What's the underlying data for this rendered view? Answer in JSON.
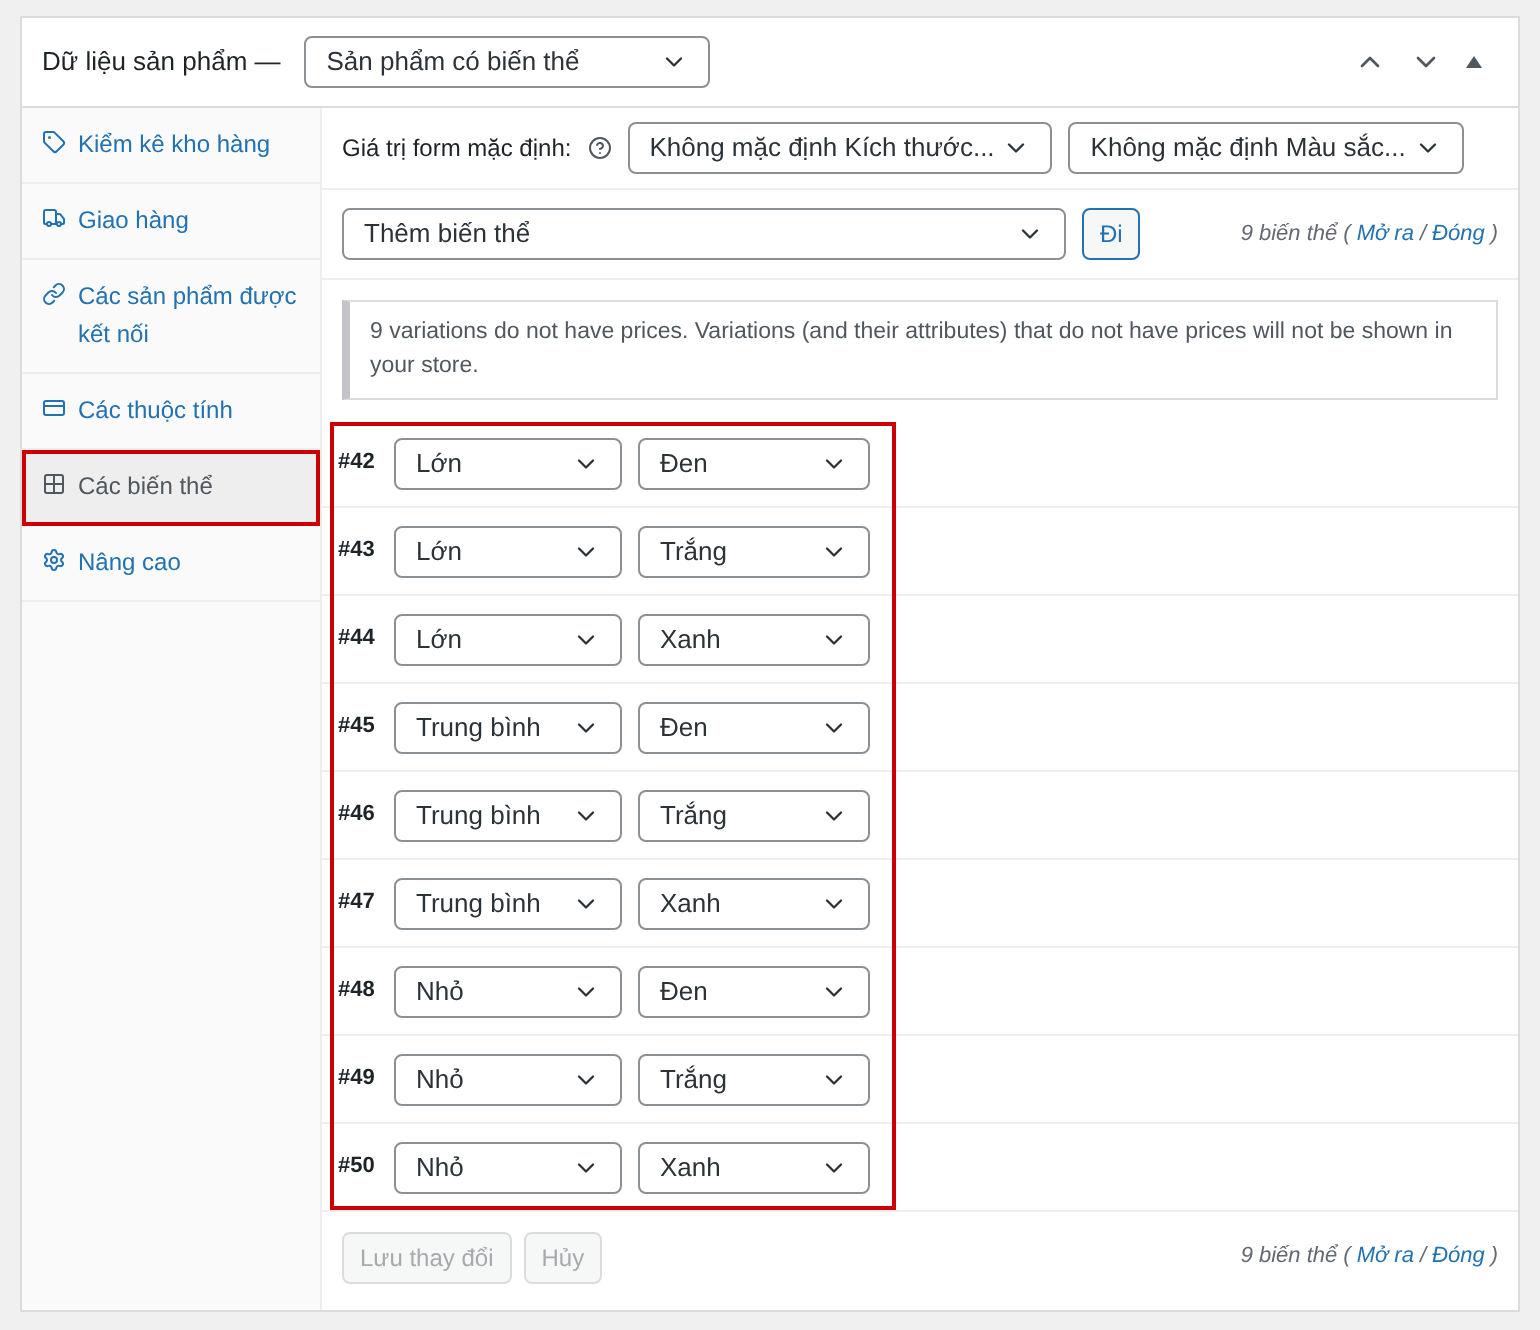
{
  "header": {
    "title": "Dữ liệu sản phẩm —",
    "product_type": "Sản phẩm có biến thể"
  },
  "sidebar": {
    "items": [
      {
        "label": "Kiểm kê kho hàng",
        "selected": false
      },
      {
        "label": "Giao hàng",
        "selected": false
      },
      {
        "label": "Các sản phẩm được kết nối",
        "selected": false
      },
      {
        "label": "Các thuộc tính",
        "selected": false
      },
      {
        "label": "Các biến thể",
        "selected": true
      },
      {
        "label": "Nâng cao",
        "selected": false
      }
    ]
  },
  "defaults": {
    "label": "Giá trị form mặc định:",
    "selects": [
      "Không mặc định Kích thước...",
      "Không mặc định Màu sắc..."
    ]
  },
  "toolbar": {
    "action": "Thêm biến thể",
    "go_button": "Đi",
    "summary": {
      "count": "9 biến thể",
      "prefix": "(",
      "expand": "Mở ra",
      "sep": "/",
      "collapse": "Đóng",
      "suffix": ")"
    }
  },
  "notice": "9 variations do not have prices. Variations (and their attributes) that do not have prices will not be shown in your store.",
  "variations": [
    {
      "id": "#42",
      "size": "Lớn",
      "shade": "Đen"
    },
    {
      "id": "#43",
      "size": "Lớn",
      "shade": "Trắng"
    },
    {
      "id": "#44",
      "size": "Lớn",
      "shade": "Xanh"
    },
    {
      "id": "#45",
      "size": "Trung bình",
      "shade": "Đen"
    },
    {
      "id": "#46",
      "size": "Trung bình",
      "shade": "Trắng"
    },
    {
      "id": "#47",
      "size": "Trung bình",
      "shade": "Xanh"
    },
    {
      "id": "#48",
      "size": "Nhỏ",
      "shade": "Đen"
    },
    {
      "id": "#49",
      "size": "Nhỏ",
      "shade": "Trắng"
    },
    {
      "id": "#50",
      "size": "Nhỏ",
      "shade": "Xanh"
    }
  ],
  "footer": {
    "buttons": [
      "Lưu thay đổi",
      "Hủy"
    ],
    "summary": {
      "count": "9 biến thể",
      "prefix": "(",
      "expand": "Mở ra",
      "sep": "/",
      "collapse": "Đóng",
      "suffix": ")"
    }
  }
}
